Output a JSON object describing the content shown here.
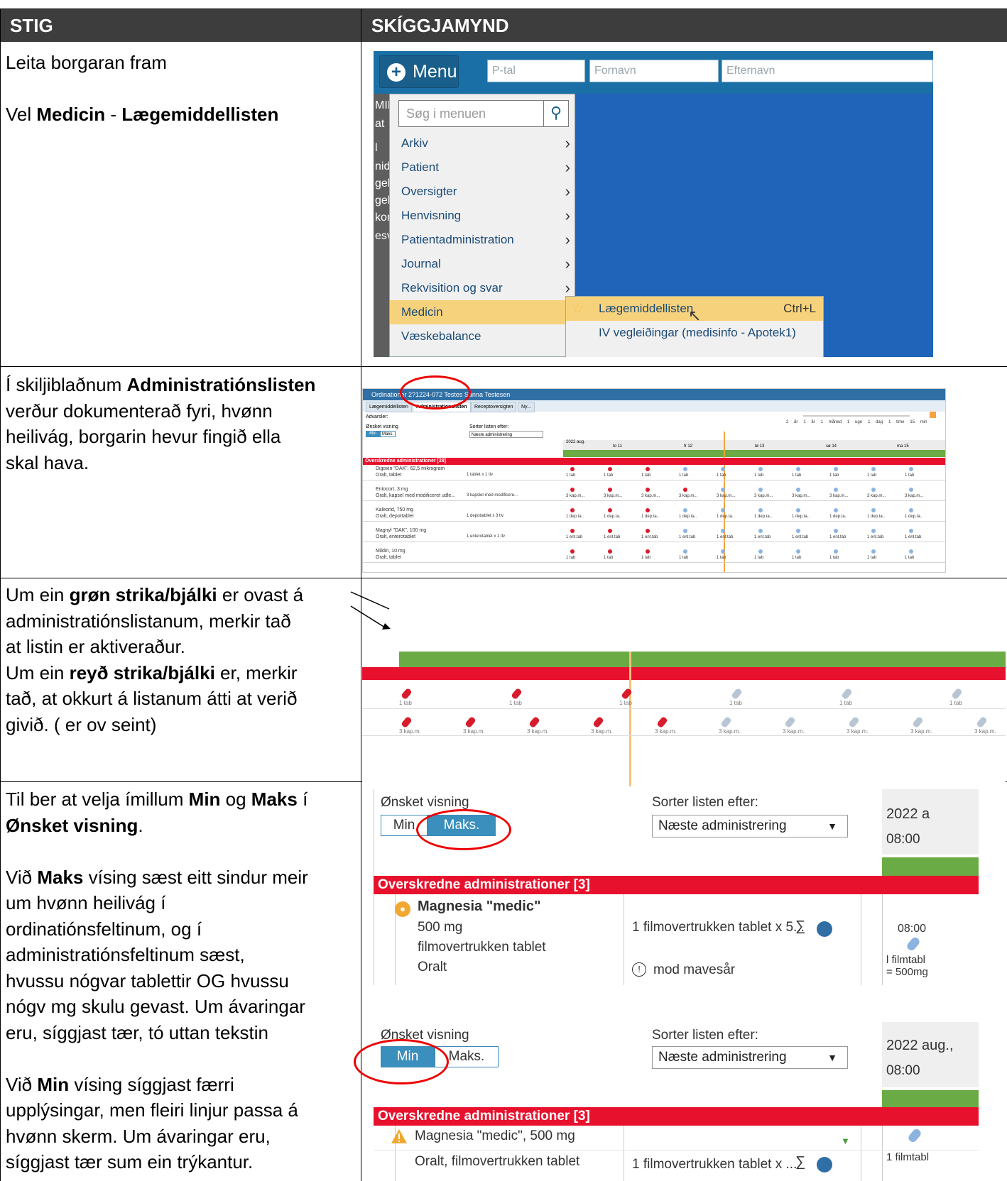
{
  "table": {
    "col_step": "STIG",
    "col_screenshot": "SKÍGGJAMYND"
  },
  "rows": [
    {
      "lines": [
        [
          {
            "t": "Leita borgaran fram"
          }
        ],
        [],
        [
          {
            "t": "Vel "
          },
          {
            "t": "Medicin",
            "b": true
          },
          {
            "t": " - "
          },
          {
            "t": "Lægemiddellisten",
            "b": true
          }
        ]
      ]
    },
    {
      "lines": [
        [
          {
            "t": "Í skiljiblaðnum "
          },
          {
            "t": "Administratiónslisten",
            "b": true
          }
        ],
        [
          {
            "t": "verður dokumenterað fyri, hvønn"
          }
        ],
        [
          {
            "t": "heilivág, borgarin hevur fingið ella"
          }
        ],
        [
          {
            "t": "skal hava."
          }
        ]
      ]
    },
    {
      "lines": [
        [
          {
            "t": "Um ein "
          },
          {
            "t": "grøn strika/bjálki",
            "b": true
          },
          {
            "t": " er ovast á"
          }
        ],
        [
          {
            "t": "administratiónslistanum, merkir tað"
          }
        ],
        [
          {
            "t": "at listin er aktiveraður."
          }
        ],
        [
          {
            "t": "Um ein "
          },
          {
            "t": "reyð strika/bjálki",
            "b": true
          },
          {
            "t": " er, merkir"
          }
        ],
        [
          {
            "t": "tað, at okkurt á listanum átti at verið"
          }
        ],
        [
          {
            "t": "givið. ( er ov seint)"
          }
        ]
      ]
    },
    {
      "lines": [
        [
          {
            "t": "Til ber at velja ímillum "
          },
          {
            "t": "Min",
            "b": true
          },
          {
            "t": " og "
          },
          {
            "t": "Maks",
            "b": true
          },
          {
            "t": " í"
          }
        ],
        [
          {
            "t": "Ønsket visning",
            "b": true
          },
          {
            "t": "."
          }
        ],
        [],
        [
          {
            "t": "Við "
          },
          {
            "t": "Maks",
            "b": true
          },
          {
            "t": " vísing sæst eitt sindur meir"
          }
        ],
        [
          {
            "t": "um hvønn heilivág í"
          }
        ],
        [
          {
            "t": "ordinatiónsfeltinum, og í"
          }
        ],
        [
          {
            "t": "administratiónsfeltinum sæst,"
          }
        ],
        [
          {
            "t": "hvussu nógvar tablettir OG hvussu"
          }
        ],
        [
          {
            "t": "nógv mg skulu gevast. Um ávaringar"
          }
        ],
        [
          {
            "t": "eru, síggjast tær, tó uttan tekstin"
          }
        ],
        [],
        [
          {
            "t": "Við "
          },
          {
            "t": "Min",
            "b": true
          },
          {
            "t": " vísing síggjast færri"
          }
        ],
        [
          {
            "t": "upplýsingar, men fleiri linjur passa á"
          }
        ],
        [
          {
            "t": "hvønn skerm. Um ávaringar eru,"
          }
        ],
        [
          {
            "t": "síggjast tær sum ein trýkantur."
          }
        ]
      ]
    }
  ],
  "shot1": {
    "menu_label": "Menu",
    "fields": [
      "P-tal",
      "Fornavn",
      "Efternavn"
    ],
    "search_placeholder": "Søg i menuen",
    "left_strip": [
      "MINE",
      "at",
      "l",
      "nidde",
      "gels",
      "gels",
      "kort",
      "esvar"
    ],
    "menu_items": [
      "Arkiv",
      "Patient",
      "Oversigter",
      "Henvisning",
      "Patientadministration",
      "Journal",
      "Rekvisition og svar",
      "Medicin",
      "Væskebalance"
    ],
    "selected_item": "Medicin",
    "submenu": [
      {
        "label": "Lægemiddellisten",
        "shortcut": "Ctrl+L"
      },
      {
        "label": "IV vegleiðingar (medisinfo - Apotek1)",
        "shortcut": ""
      }
    ]
  },
  "shot2": {
    "title": "Ordinationer 2?1224-072 Testes Sanna Testesen",
    "tabs": [
      "Lægemiddellisten",
      "Administrationslisten",
      "Receptoversigten",
      "Ny..."
    ],
    "warnings_label": "Advarsler:",
    "view_label": "Ønsket visning",
    "view_min": "Min",
    "view_max": "Maks.",
    "sort_label": "Sorter listen efter:",
    "sort_value": "Næste administrering",
    "zoom_labels": [
      "2 år",
      "1 år",
      "1 måned",
      "1 uge",
      "1 dag",
      "1 time",
      "15 min"
    ],
    "month": "2022 aug.",
    "days": [
      "to 11",
      "fr 12",
      "lø 13",
      "sø 14",
      "ma 15"
    ],
    "overdue": "Overskredne administrationer [28]",
    "meds": [
      {
        "name": "Digoxin \"DAK\", 62,5 mikrogram",
        "route": "Oralt, tablet",
        "dose": "1 tablet x 1 tlv",
        "tag": "1 tab",
        "red": 3
      },
      {
        "name": "Entocort, 3 mg",
        "route": "Oralt, kapsel med modificeret udle...",
        "dose": "3 kapsler med modificere...",
        "tag": "3 kap.m...",
        "red": 4
      },
      {
        "name": "Kaleorid, 750 mg",
        "route": "Oralt, depottablet",
        "dose": "1 depottablet x 3 tlv",
        "tag": "1 dep.ta..",
        "red": 3
      },
      {
        "name": "Magnyl \"DAK\", 100 mg",
        "route": "Oralt, enterotablet",
        "dose": "1 enterotablet x 1 tlv",
        "tag": "1 ent.tab",
        "red": 3
      },
      {
        "name": "Mildin, 10 mg",
        "route": "Oralt, tablet",
        "dose": "",
        "tag": "1 tab",
        "red": 3
      }
    ]
  },
  "shot3": {
    "tags_row1": [
      "1 tab",
      "1 tab",
      "1 tab",
      "1 tab",
      "1 tab",
      "1 tab"
    ],
    "tags_row2": [
      "3 kap.m.",
      "3 kap.m.",
      "3 kap.m.",
      "3 kap.m.",
      "3 kap.m.",
      "3 kap.m.",
      "3 kap.m.",
      "3 kap.m.",
      "3 kap.m.",
      "3 kap.m."
    ]
  },
  "shot4": {
    "view_label": "Ønsket visning",
    "min": "Min",
    "max": "Maks.",
    "sort_label": "Sorter listen efter:",
    "sort_value": "Næste administrering",
    "date": "2022 a",
    "time": "08:00",
    "overdue": "Overskredne administrationer [3]",
    "med_name": "Magnesia \"medic\"",
    "med_strength": "500 mg",
    "med_form": "filmovertrukken tablet",
    "med_route": "Oralt",
    "dose": "1 filmovertrukken tablet x 5...",
    "warning": "mod mavesår",
    "cell_time": "08:00",
    "cell_line1": "l filmtabl",
    "cell_line2": "= 500mg"
  },
  "shot5": {
    "view_label": "Ønsket visning",
    "min": "Min",
    "max": "Maks.",
    "sort_label": "Sorter listen efter:",
    "sort_value": "Næste administrering",
    "date": "2022 aug.,",
    "time": "08:00",
    "overdue": "Overskredne administrationer [3]",
    "med_name": "Magnesia \"medic\", 500 mg",
    "med_route": "Oralt, filmovertrukken tablet",
    "dose": "1 filmovertrukken tablet x ...",
    "cell": "1 filmtabl"
  }
}
